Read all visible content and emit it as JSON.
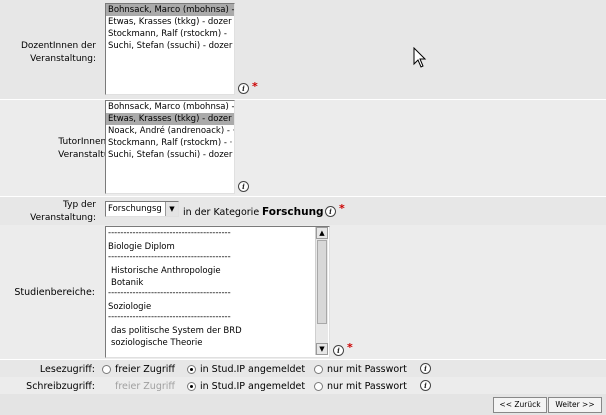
{
  "lecturers": {
    "label_line1": "DozentInnen der",
    "label_line2": "Veranstaltung:",
    "options": [
      "Bohnsack, Marco (mbohnsa) -",
      "Etwas, Krasses (tkkg) - dozer",
      "Stockmann, Ralf (rstockm) -",
      "Suchi, Stefan (ssuchi) - dozer"
    ],
    "selected_index": 0
  },
  "tutors": {
    "label_line1": "TutorInnen der",
    "label_line2": "Veranstaltung:",
    "options": [
      "Bohnsack, Marco (mbohnsa) -",
      "Etwas, Krasses (tkkg) - dozer",
      "Noack, André (andrenoack) - ·",
      "Stockmann, Ralf (rstockm) - ·",
      "Suchi, Stefan (ssuchi) - dozer"
    ],
    "selected_index": 1
  },
  "type": {
    "label_line1": "Typ der",
    "label_line2": "Veranstaltung:",
    "selected": "Forschungsg",
    "category_prefix": "in der Kategorie",
    "category_value": "Forschung"
  },
  "studies": {
    "label": "Studienbereiche:",
    "items": [
      "----------------------------------------",
      "Biologie Diplom",
      "----------------------------------------",
      "Historische Anthropologie",
      "Botanik",
      "----------------------------------------",
      "Soziologie",
      "----------------------------------------",
      "das politische System der BRD",
      "soziologische Theorie"
    ]
  },
  "read_access": {
    "label": "Lesezugriff:",
    "options": [
      "freier Zugriff",
      "in Stud.IP angemeldet",
      "nur mit Passwort"
    ],
    "selected_index": 1
  },
  "write_access": {
    "label": "Schreibzugriff:",
    "options": [
      "freier Zugriff",
      "in Stud.IP angemeldet",
      "nur mit Passwort"
    ],
    "selected_index": 1,
    "disabled_index": 0
  },
  "buttons": {
    "back": "<< Zurück",
    "next": "Weiter >>"
  },
  "icons": {
    "info": "info-icon",
    "required": "required-star-icon",
    "cursor": "mouse-pointer-icon"
  },
  "colors": {
    "required": "#cc0000",
    "selected_option": "#aaaaaa",
    "disabled_text": "#a0a0a0"
  }
}
